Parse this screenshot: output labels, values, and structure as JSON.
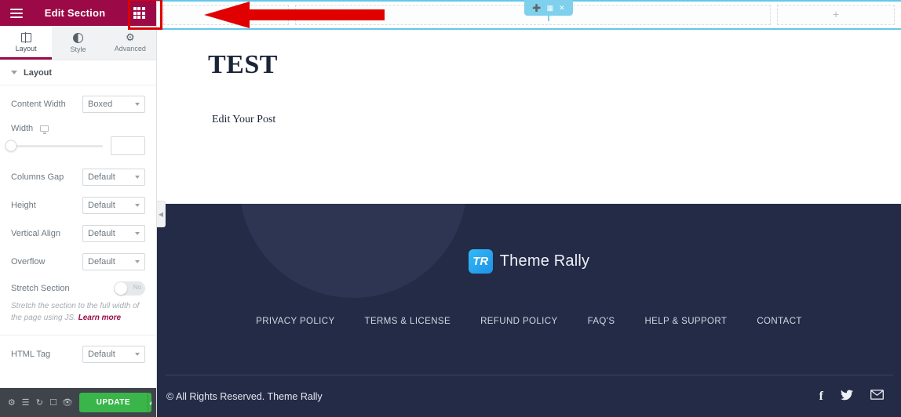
{
  "panel": {
    "header": {
      "title": "Edit Section",
      "menu_icon": "hamburger-menu-icon",
      "apps_icon": "apps-grid-icon"
    },
    "tabs": [
      {
        "label": "Layout",
        "icon": "layout-icon",
        "active": true
      },
      {
        "label": "Style",
        "icon": "contrast-icon",
        "active": false
      },
      {
        "label": "Advanced",
        "icon": "gear-icon",
        "active": false
      }
    ],
    "section_title": "Layout",
    "controls": [
      {
        "label": "Content Width",
        "value": "Boxed"
      },
      {
        "label": "Columns Gap",
        "value": "Default"
      },
      {
        "label": "Height",
        "value": "Default"
      },
      {
        "label": "Vertical Align",
        "value": "Default"
      },
      {
        "label": "Overflow",
        "value": "Default"
      },
      {
        "label": "HTML Tag",
        "value": "Default"
      }
    ],
    "width_control": {
      "label": "Width",
      "device_icon": "desktop-icon",
      "value": "",
      "placeholder": ""
    },
    "stretch": {
      "label": "Stretch Section",
      "toggle_text": "No",
      "toggle_on": false
    },
    "stretch_hint": "Stretch the section to the full width of the page using JS.",
    "stretch_hint_link": "Learn more",
    "footer_toolbar": {
      "icons": [
        "settings-icon",
        "layers-icon",
        "history-icon",
        "responsive-icon",
        "preview-icon"
      ],
      "update_label": "UPDATE",
      "update_caret": "caret-up-icon"
    }
  },
  "editor": {
    "section_handle": {
      "add": "plus-icon",
      "columns": "grid-icon",
      "close": "close-icon"
    },
    "add_section_placeholder": "+",
    "annotation": {
      "type": "red-arrow-left",
      "color": "#e00000"
    },
    "highlight_color": "#e00000"
  },
  "page": {
    "heading": "TEST",
    "subheading": "Edit Your Post",
    "footer": {
      "brand": {
        "logo_text": "TR",
        "name": "Theme Rally"
      },
      "nav": [
        "PRIVACY POLICY",
        "TERMS & LICENSE",
        "REFUND POLICY",
        "FAQ'S",
        "HELP & SUPPORT",
        "CONTACT"
      ],
      "copyright": "© All Rights Reserved. Theme Rally",
      "socials": [
        {
          "name": "facebook-icon",
          "glyph": "f"
        },
        {
          "name": "twitter-icon",
          "glyph": "🐦"
        },
        {
          "name": "email-icon",
          "glyph": "✉"
        }
      ]
    }
  },
  "colors": {
    "panel_header": "#9b0a46",
    "accent": "#9b0a46",
    "update_green": "#39b54a",
    "section_blue": "#7fd0ec",
    "footer_navy": "#242b47",
    "highlight_red": "#e00000"
  }
}
